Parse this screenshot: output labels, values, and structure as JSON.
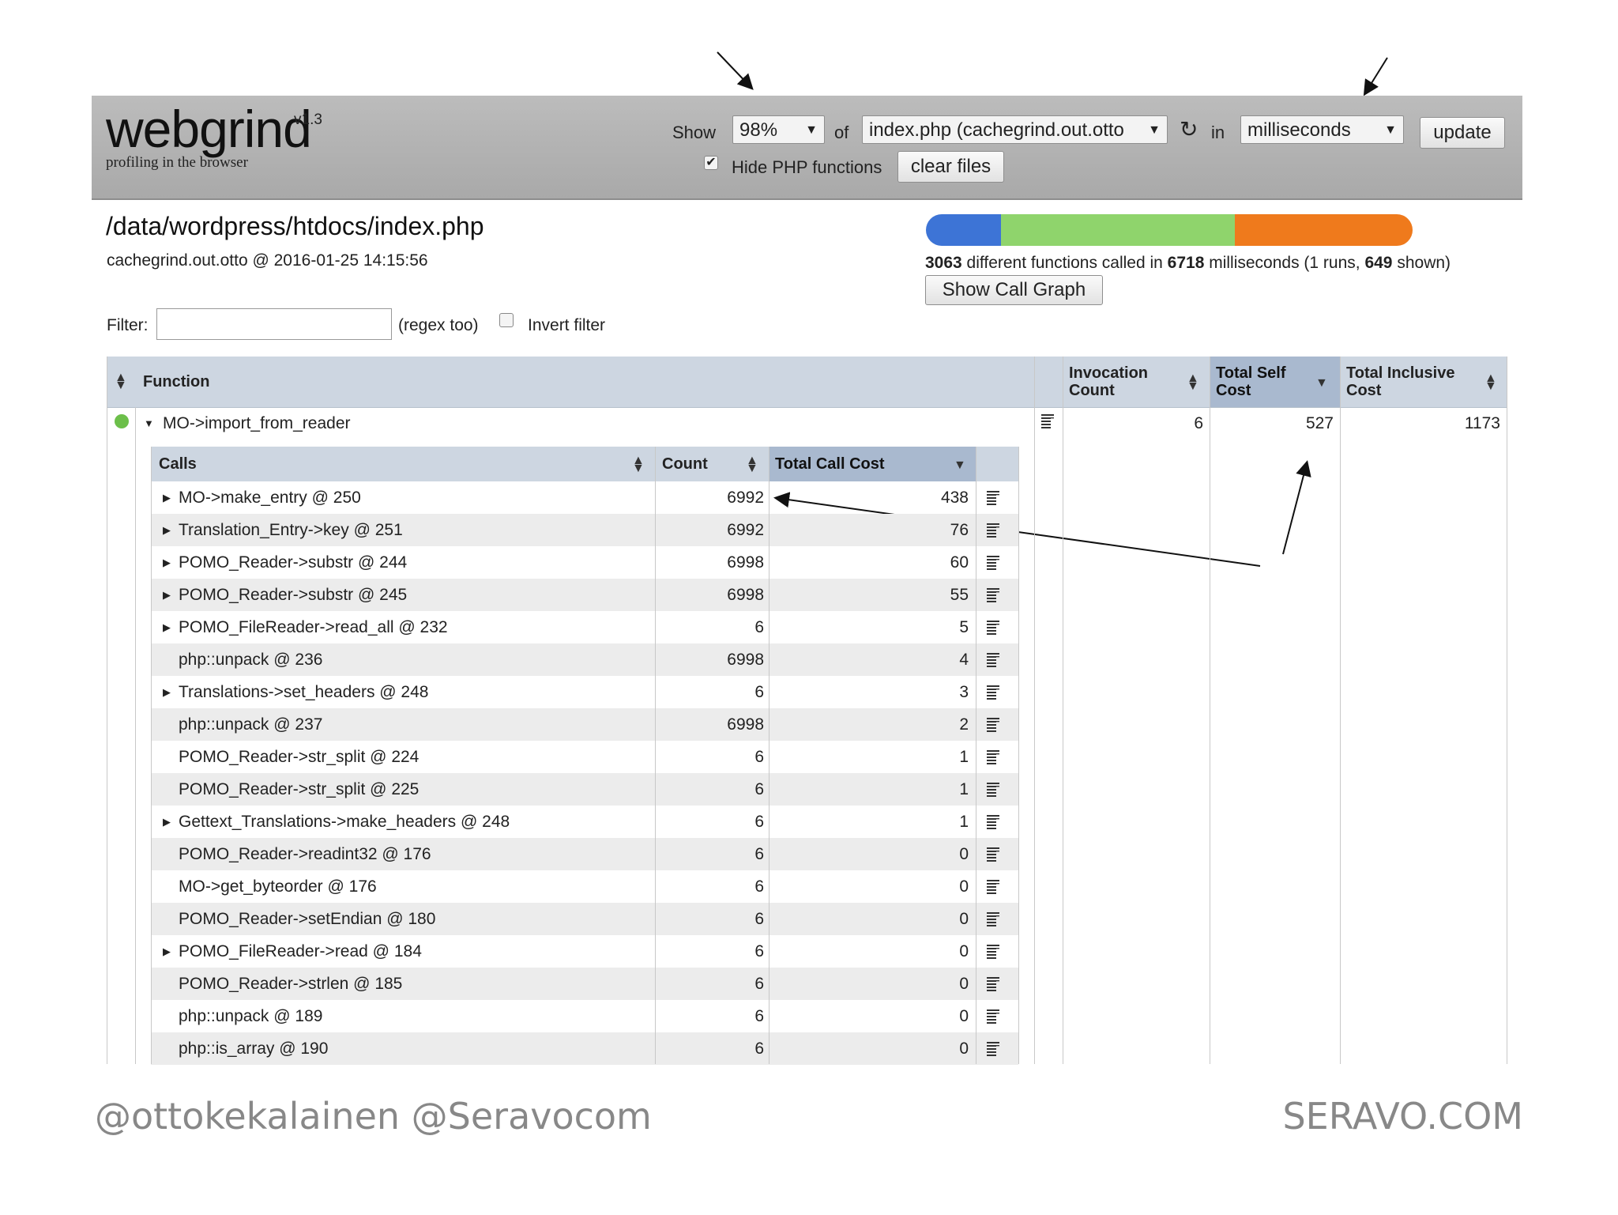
{
  "header": {
    "logo": "webgrind",
    "version": "v1.3",
    "tagline": "profiling in the browser",
    "show_label": "Show",
    "percent_value": "98%",
    "of_label": "of",
    "file_value": "index.php (cachegrind.out.otto",
    "in_label": "in",
    "unit_value": "milliseconds",
    "update_label": "update",
    "hide_php_label": "Hide PHP functions",
    "hide_php_checked": true,
    "clear_files_label": "clear files"
  },
  "page": {
    "title": "/data/wordpress/htdocs/index.php",
    "subtitle": "cachegrind.out.otto @ 2016-01-25 14:15:56",
    "stats": {
      "functions": "3063",
      "text1": " different functions called in ",
      "ms": "6718",
      "text2": " milliseconds (1 runs, ",
      "shown": "649",
      "text3": " shown)"
    },
    "progress": [
      {
        "color": "#3d74d6",
        "fraction": 0.155
      },
      {
        "color": "#8fd46c",
        "fraction": 0.48
      },
      {
        "color": "#ef7a1c",
        "fraction": 0.365
      }
    ],
    "call_graph_label": "Show Call Graph",
    "filter_label": "Filter:",
    "regex_label": "(regex too)",
    "invert_label": "Invert filter"
  },
  "table": {
    "headers": {
      "function": "Function",
      "invocation_count": "Invocation Count",
      "total_self_cost": "Total Self Cost",
      "total_inclusive_cost": "Total Inclusive Cost"
    },
    "row": {
      "function": "MO->import_from_reader",
      "invocation_count": "6",
      "total_self_cost": "527",
      "total_inclusive_cost": "1173"
    },
    "calls_headers": {
      "calls": "Calls",
      "count": "Count",
      "total_call_cost": "Total Call Cost"
    },
    "calls": [
      {
        "name": "MO->make_entry @ 250",
        "count": "6992",
        "cost": "438",
        "expandable": true
      },
      {
        "name": "Translation_Entry->key @ 251",
        "count": "6992",
        "cost": "76",
        "expandable": true
      },
      {
        "name": "POMO_Reader->substr @ 244",
        "count": "6998",
        "cost": "60",
        "expandable": true
      },
      {
        "name": "POMO_Reader->substr @ 245",
        "count": "6998",
        "cost": "55",
        "expandable": true
      },
      {
        "name": "POMO_FileReader->read_all @ 232",
        "count": "6",
        "cost": "5",
        "expandable": true
      },
      {
        "name": "php::unpack @ 236",
        "count": "6998",
        "cost": "4",
        "expandable": false
      },
      {
        "name": "Translations->set_headers @ 248",
        "count": "6",
        "cost": "3",
        "expandable": true
      },
      {
        "name": "php::unpack @ 237",
        "count": "6998",
        "cost": "2",
        "expandable": false
      },
      {
        "name": "POMO_Reader->str_split @ 224",
        "count": "6",
        "cost": "1",
        "expandable": false
      },
      {
        "name": "POMO_Reader->str_split @ 225",
        "count": "6",
        "cost": "1",
        "expandable": false
      },
      {
        "name": "Gettext_Translations->make_headers @ 248",
        "count": "6",
        "cost": "1",
        "expandable": true
      },
      {
        "name": "POMO_Reader->readint32 @ 176",
        "count": "6",
        "cost": "0",
        "expandable": false
      },
      {
        "name": "MO->get_byteorder @ 176",
        "count": "6",
        "cost": "0",
        "expandable": false
      },
      {
        "name": "POMO_Reader->setEndian @ 180",
        "count": "6",
        "cost": "0",
        "expandable": false
      },
      {
        "name": "POMO_FileReader->read @ 184",
        "count": "6",
        "cost": "0",
        "expandable": true
      },
      {
        "name": "POMO_Reader->strlen @ 185",
        "count": "6",
        "cost": "0",
        "expandable": false
      },
      {
        "name": "php::unpack @ 189",
        "count": "6",
        "cost": "0",
        "expandable": false
      },
      {
        "name": "php::is_array @ 190",
        "count": "6",
        "cost": "0",
        "expandable": false
      }
    ]
  },
  "footer": {
    "left": "@ottokekalainen @Seravocom",
    "right": "SERAVO.COM"
  }
}
